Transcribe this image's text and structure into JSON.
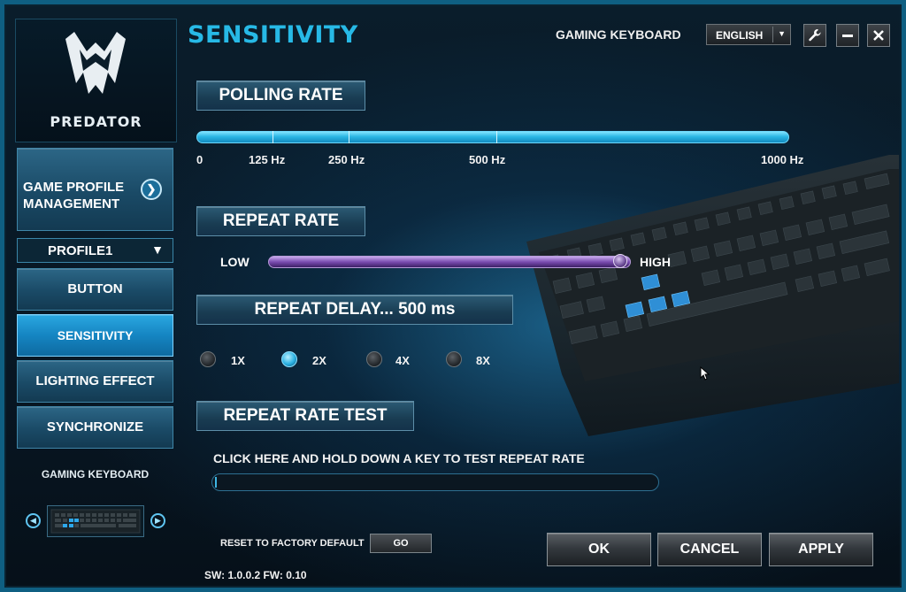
{
  "app": {
    "brand": "PREDATOR",
    "page_title": "SENSITIVITY",
    "device_name": "GAMING KEYBOARD",
    "language": "ENGLISH"
  },
  "sidebar": {
    "game_profile_management": "GAME PROFILE MANAGEMENT",
    "game_profile_line1": "GAME PROFILE",
    "game_profile_line2": "MANAGEMENT",
    "profile": "PROFILE1",
    "items": [
      {
        "label": "BUTTON",
        "active": false
      },
      {
        "label": "SENSITIVITY",
        "active": true
      },
      {
        "label": "LIGHTING EFFECT",
        "active": false
      },
      {
        "label": "SYNCHRONIZE",
        "active": false
      }
    ],
    "device_label": "GAMING KEYBOARD"
  },
  "polling_rate": {
    "label": "POLLING RATE",
    "ticks": [
      "0",
      "125 Hz",
      "250 Hz",
      "500 Hz",
      "1000 Hz"
    ]
  },
  "repeat_rate": {
    "label": "REPEAT RATE",
    "low": "LOW",
    "high": "HIGH",
    "level": 0.97
  },
  "repeat_delay": {
    "label": "REPEAT DELAY... 500 ms",
    "options": [
      "1X",
      "2X",
      "4X",
      "8X"
    ],
    "selected": "2X"
  },
  "repeat_rate_test": {
    "label": "REPEAT RATE TEST",
    "instruction": "CLICK HERE AND HOLD DOWN A KEY TO TEST REPEAT RATE",
    "value": ""
  },
  "footer": {
    "reset_label": "RESET TO FACTORY DEFAULT",
    "go_label": "GO",
    "version": "SW: 1.0.0.2   FW: 0.10",
    "ok_label": "OK",
    "cancel_label": "CANCEL",
    "apply_label": "APPLY"
  },
  "colors": {
    "accent": "#27b9e6",
    "frame": "#0f5f82",
    "repeat_track": "#7a4cb0"
  },
  "icons": {
    "settings": "wrench-icon",
    "minimize": "minimize-icon",
    "close": "close-icon",
    "gpm_arrow": "chevron-right-circle-icon"
  }
}
